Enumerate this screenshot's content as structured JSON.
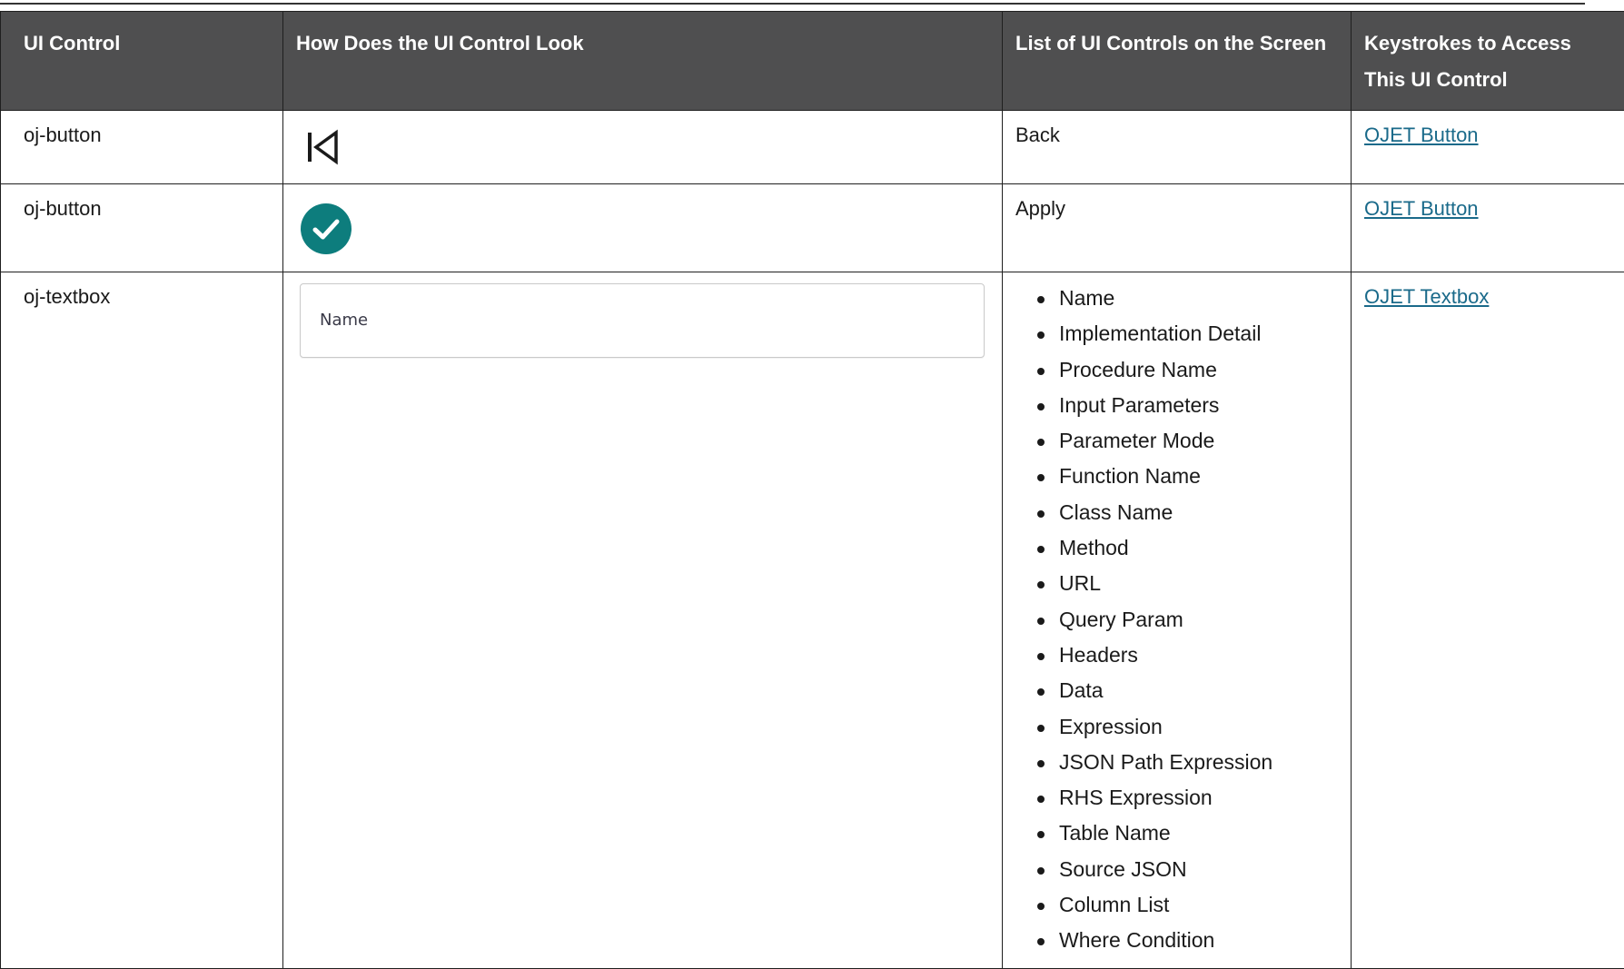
{
  "table": {
    "headers": [
      "UI Control",
      "How Does the UI Control Look",
      "List of UI Controls on the Screen",
      "Keystrokes to Access This UI Control"
    ],
    "rows": [
      {
        "control": "oj-button",
        "icon": "back-to-start-icon",
        "screen_controls": "Back",
        "keystroke_link": "OJET Button"
      },
      {
        "control": "oj-button",
        "icon": "check-circle-icon",
        "accent_color": "#0d7d7d",
        "screen_controls": "Apply",
        "keystroke_link": "OJET Button"
      },
      {
        "control": "oj-textbox",
        "textbox_label": "Name",
        "screen_controls_list": [
          "Name",
          "Implementation Detail",
          "Procedure Name",
          "Input Parameters",
          "Parameter Mode",
          "Function Name",
          "Class Name",
          "Method",
          "URL",
          "Query Param",
          "Headers",
          "Data",
          "Expression",
          "JSON Path Expression",
          "RHS Expression",
          "Table Name",
          "Source JSON",
          "Column List",
          "Where Condition"
        ],
        "keystroke_link": "OJET Textbox"
      }
    ]
  },
  "colors": {
    "header_bg": "#4f4f50",
    "header_text": "#ffffff",
    "link": "#1a6a8a",
    "check_icon": "#0d7d7d"
  }
}
